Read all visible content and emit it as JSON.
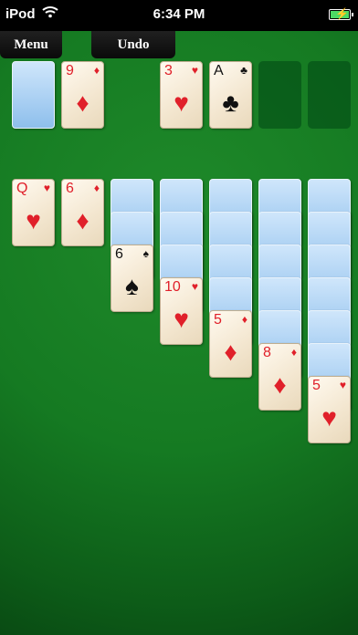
{
  "status_bar": {
    "carrier": "iPod",
    "time": "6:34 PM"
  },
  "toolbar": {
    "menu_label": "Menu",
    "undo_label": "Undo"
  },
  "top_row": {
    "waste": {
      "rank": "9",
      "suit": "♦",
      "color": "red"
    },
    "foundations": [
      {
        "rank": "3",
        "suit": "♥",
        "color": "red"
      },
      {
        "rank": "A",
        "suit": "♣",
        "color": "black"
      }
    ]
  },
  "tableau": [
    {
      "hidden": 0,
      "rank": "Q",
      "suit": "♥",
      "color": "red"
    },
    {
      "hidden": 0,
      "rank": "6",
      "suit": "♦",
      "color": "red"
    },
    {
      "hidden": 2,
      "rank": "6",
      "suit": "♠",
      "color": "black"
    },
    {
      "hidden": 3,
      "rank": "10",
      "suit": "♥",
      "color": "red"
    },
    {
      "hidden": 4,
      "rank": "5",
      "suit": "♦",
      "color": "red"
    },
    {
      "hidden": 5,
      "rank": "8",
      "suit": "♦",
      "color": "red"
    },
    {
      "hidden": 6,
      "rank": "5",
      "suit": "♥",
      "color": "red"
    }
  ],
  "colors": {
    "felt": "#157a22",
    "card_back": "#8ebfec",
    "red_suit": "#e0202a"
  }
}
